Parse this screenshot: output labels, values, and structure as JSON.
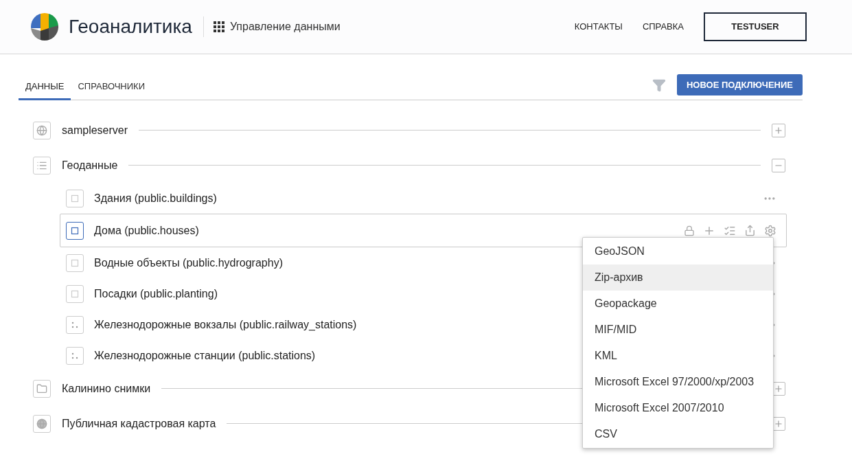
{
  "header": {
    "brand": "Геоаналитика",
    "section": "Управление данными",
    "links": [
      "КОНТАКТЫ",
      "СПРАВКА"
    ],
    "user": "TESTUSER"
  },
  "tabs": [
    {
      "label": "ДАННЫЕ",
      "selected": true
    },
    {
      "label": "СПРАВОЧНИКИ",
      "selected": false
    }
  ],
  "new_connection_button": "НОВОЕ ПОДКЛЮЧЕНИЕ",
  "tree": [
    {
      "kind": "server",
      "label": "sampleserver",
      "expanded": false
    },
    {
      "kind": "dataset",
      "label": "Геоданные",
      "expanded": true,
      "children": [
        {
          "kind": "polygon",
          "label": "Здания (public.buildings)",
          "selected": false
        },
        {
          "kind": "polygon",
          "label": "Дома (public.houses)",
          "selected": true,
          "menu": [
            {
              "label": "GeoJSON",
              "highlighted": false
            },
            {
              "label": "Zip-архив",
              "highlighted": true
            },
            {
              "label": "Geopackage",
              "highlighted": false
            },
            {
              "label": "MIF/MID",
              "highlighted": false
            },
            {
              "label": "KML",
              "highlighted": false
            },
            {
              "label": "Microsoft Excel 97/2000/xp/2003",
              "highlighted": false
            },
            {
              "label": "Microsoft Excel 2007/2010",
              "highlighted": false
            },
            {
              "label": "CSV",
              "highlighted": false
            }
          ]
        },
        {
          "kind": "polygon",
          "label": "Водные объекты (public.hydrography)",
          "selected": false
        },
        {
          "kind": "polygon",
          "label": "Посадки (public.planting)",
          "selected": false
        },
        {
          "kind": "point",
          "label": "Железнодорожные вокзалы (public.railway_stations)",
          "selected": false
        },
        {
          "kind": "point",
          "label": "Железнодорожные станции (public.stations)",
          "selected": false
        }
      ]
    },
    {
      "kind": "folder",
      "label": "Калинино снимки",
      "expanded": false
    },
    {
      "kind": "map",
      "label": "Публичная кадастровая карта",
      "expanded": false
    }
  ]
}
